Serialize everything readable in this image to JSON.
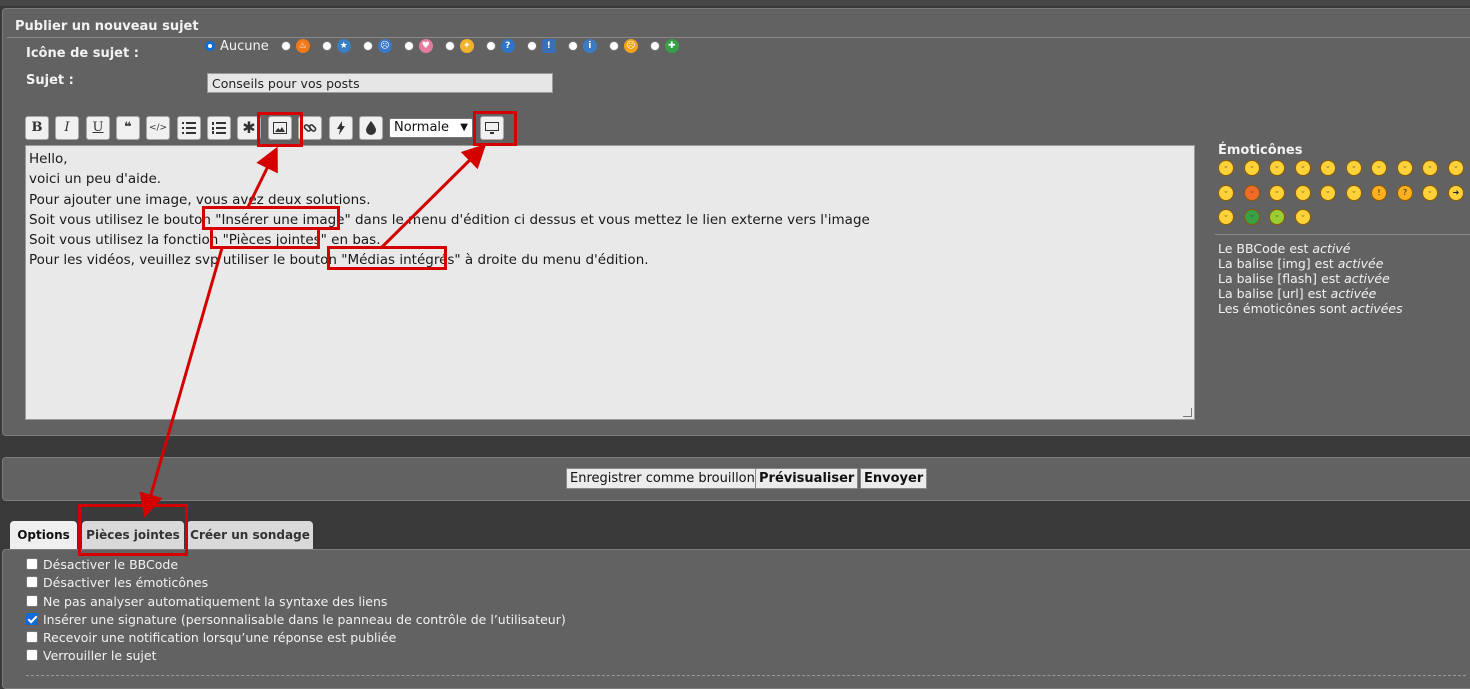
{
  "form": {
    "title": "Publier un nouveau sujet",
    "icon_label": "Icône de sujet :",
    "subject_label": "Sujet :",
    "icon_none": "Aucune",
    "topic_icons": [
      "flame-icon",
      "star-icon",
      "surprised-icon",
      "heart-icon",
      "sparkle-icon",
      "question-icon",
      "warning-icon",
      "info-icon",
      "sad-icon",
      "thumbs-icon"
    ],
    "subject_value": "Conseils pour vos posts"
  },
  "toolbar": {
    "bold": "B",
    "italic": "I",
    "underline": "U",
    "quote": "❝",
    "code": "</>",
    "size_value": "Normale",
    "buttons": [
      "bold",
      "italic",
      "underline",
      "quote",
      "code",
      "list",
      "numbered-list",
      "list-item",
      "image",
      "link",
      "flash",
      "color",
      "size",
      "media"
    ]
  },
  "editor": {
    "lines": [
      "Hello,",
      "voici un peu d'aide.",
      "Pour ajouter une image, vous avez deux solutions.",
      "Soit vous utilisez le bouton \"Insérer une image\" dans le menu d'édition ci dessus et vous mettez le lien externe vers l'image",
      "Soit vous utilisez la fonction \"Pièces jointes\" en bas.",
      "Pour les vidéos, veuillez svp utiliser le bouton \"Médias intégrés\" à droite du menu d'édition."
    ]
  },
  "sidebar": {
    "emoticons_title": "Émoticônes",
    "status": [
      {
        "prefix": "Le BBCode est ",
        "state": "activé"
      },
      {
        "prefix": "La balise [img] est ",
        "state": "activée"
      },
      {
        "prefix": "La balise [flash] est ",
        "state": "activée"
      },
      {
        "prefix": "La balise [url] est ",
        "state": "activée"
      },
      {
        "prefix": "Les émoticônes sont ",
        "state": "activées"
      }
    ]
  },
  "actions": {
    "save_draft": "Enregistrer comme brouillon",
    "preview": "Prévisualiser",
    "submit": "Envoyer"
  },
  "tabs": [
    "Options",
    "Pièces jointes",
    "Créer un sondage"
  ],
  "options": [
    {
      "label": "Désactiver le BBCode",
      "checked": false
    },
    {
      "label": "Désactiver les émoticônes",
      "checked": false
    },
    {
      "label": "Ne pas analyser automatiquement la syntaxe des liens",
      "checked": false
    },
    {
      "label": "Insérer une signature (personnalisable dans le panneau de contrôle de l’utilisateur)",
      "checked": true
    },
    {
      "label": "Recevoir une notification lorsqu’une réponse est publiée",
      "checked": false
    },
    {
      "label": "Verrouiller le sujet",
      "checked": false
    }
  ],
  "colors": {
    "highlight": "#d40000",
    "panel": "#626262",
    "accent": "#0b6bd8"
  }
}
